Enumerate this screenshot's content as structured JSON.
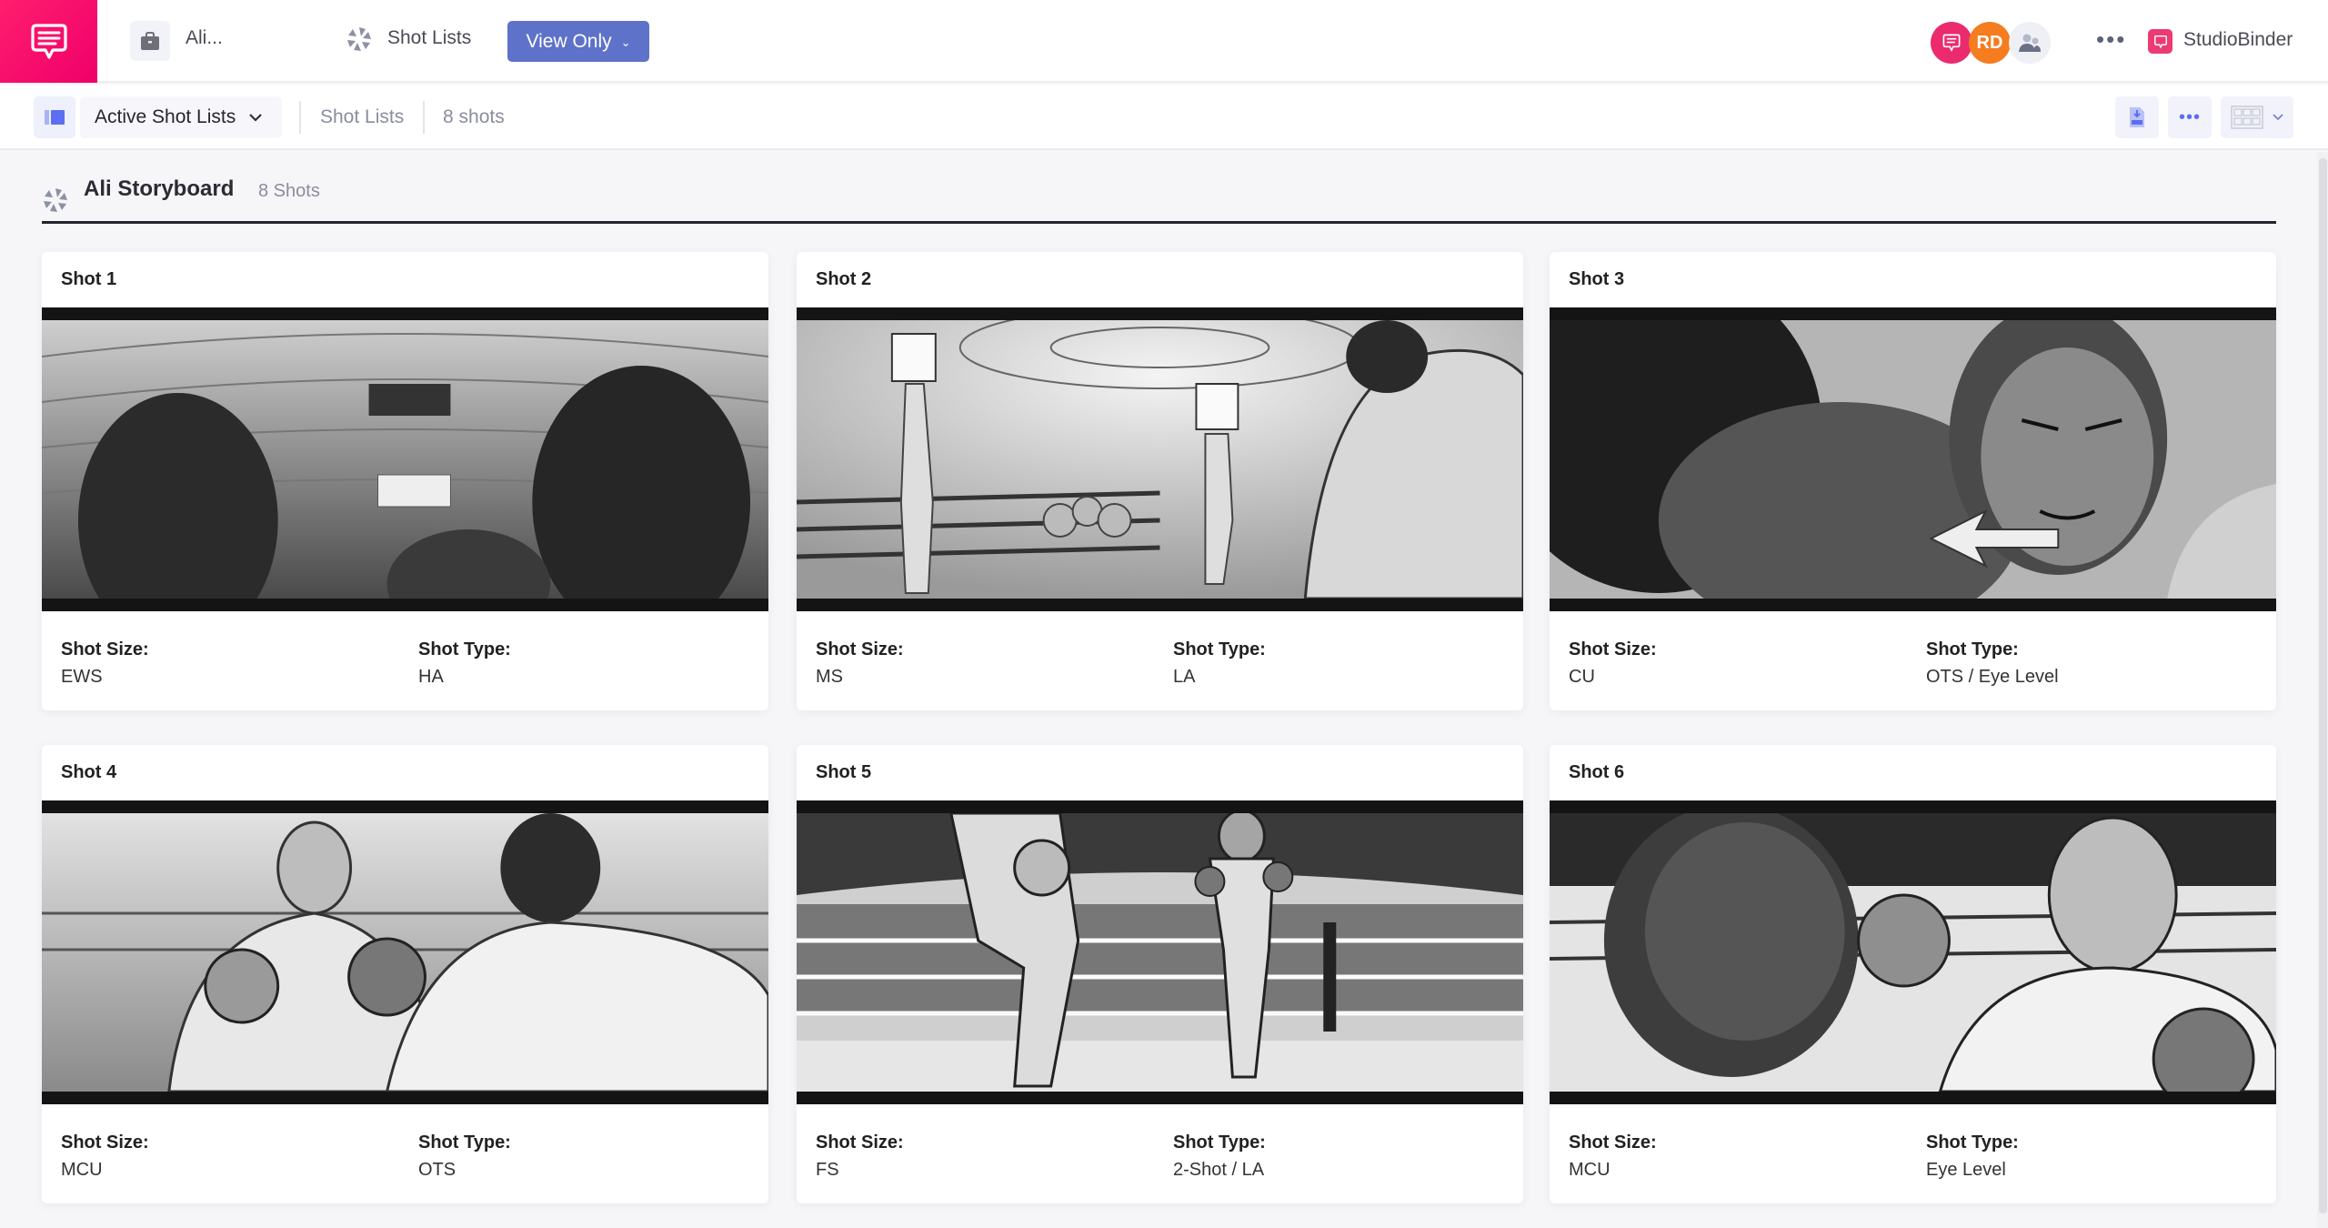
{
  "topbar": {
    "project_name": "Ali...",
    "nav_label": "Shot Lists",
    "view_mode_label": "View Only",
    "avatars": [
      {
        "type": "icon",
        "icon": "chat-bubble-icon",
        "color": "#ec2a6e"
      },
      {
        "type": "initials",
        "initials": "RD",
        "color": "#f57c1f"
      },
      {
        "type": "icon",
        "icon": "people-icon",
        "color": "#eef0f5"
      }
    ],
    "brand_name": "StudioBinder",
    "accent_color": "#ea3b73"
  },
  "subbar": {
    "dropdown_label": "Active Shot Lists",
    "breadcrumb": "Shot Lists",
    "shot_count": "8 shots",
    "tools": [
      "pdf-download-icon",
      "more-icon",
      "grid-layout-icon"
    ]
  },
  "sheet": {
    "title": "Ali Storyboard",
    "count": "8 Shots"
  },
  "labels": {
    "size": "Shot Size:",
    "type": "Shot Type:"
  },
  "shots": [
    {
      "title": "Shot  1",
      "size": "EWS",
      "type": "HA",
      "scene": "arena-crowd-overhead"
    },
    {
      "title": "Shot  2",
      "size": "MS",
      "type": "LA",
      "scene": "ring-card-girls-round-15"
    },
    {
      "title": "Shot  3",
      "size": "CU",
      "type": "OTS / Eye Level",
      "scene": "boxer-face-closeup"
    },
    {
      "title": "Shot  4",
      "size": "MCU",
      "type": "OTS",
      "scene": "boxers-facing-off"
    },
    {
      "title": "Shot  5",
      "size": "FS",
      "type": "2-Shot / LA",
      "scene": "boxers-in-ring-full"
    },
    {
      "title": "Shot  6",
      "size": "MCU",
      "type": "Eye Level",
      "scene": "punch-impact"
    }
  ]
}
